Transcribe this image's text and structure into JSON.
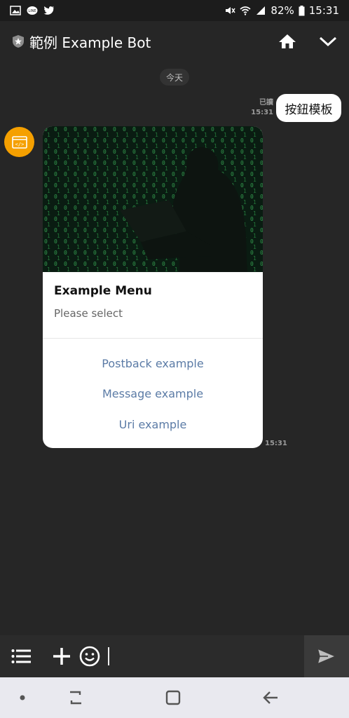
{
  "status_bar": {
    "battery": "82%",
    "time": "15:31"
  },
  "header": {
    "title": "範例 Example Bot",
    "home_icon": "home-icon",
    "collapse_icon": "chevron-down-icon"
  },
  "chat": {
    "date_label": "今天",
    "outgoing": {
      "read_label": "已讀",
      "time": "15:31",
      "text": "按鈕模板"
    },
    "card": {
      "title": "Example Menu",
      "subtitle": "Please select",
      "actions": [
        {
          "label": "Postback example"
        },
        {
          "label": "Message example"
        },
        {
          "label": "Uri example"
        }
      ],
      "time": "15:31"
    }
  },
  "input_bar": {
    "value": "",
    "placeholder": ""
  },
  "colors": {
    "background": "#262626",
    "avatar": "#f5a000",
    "action_link": "#5b7ba6"
  }
}
